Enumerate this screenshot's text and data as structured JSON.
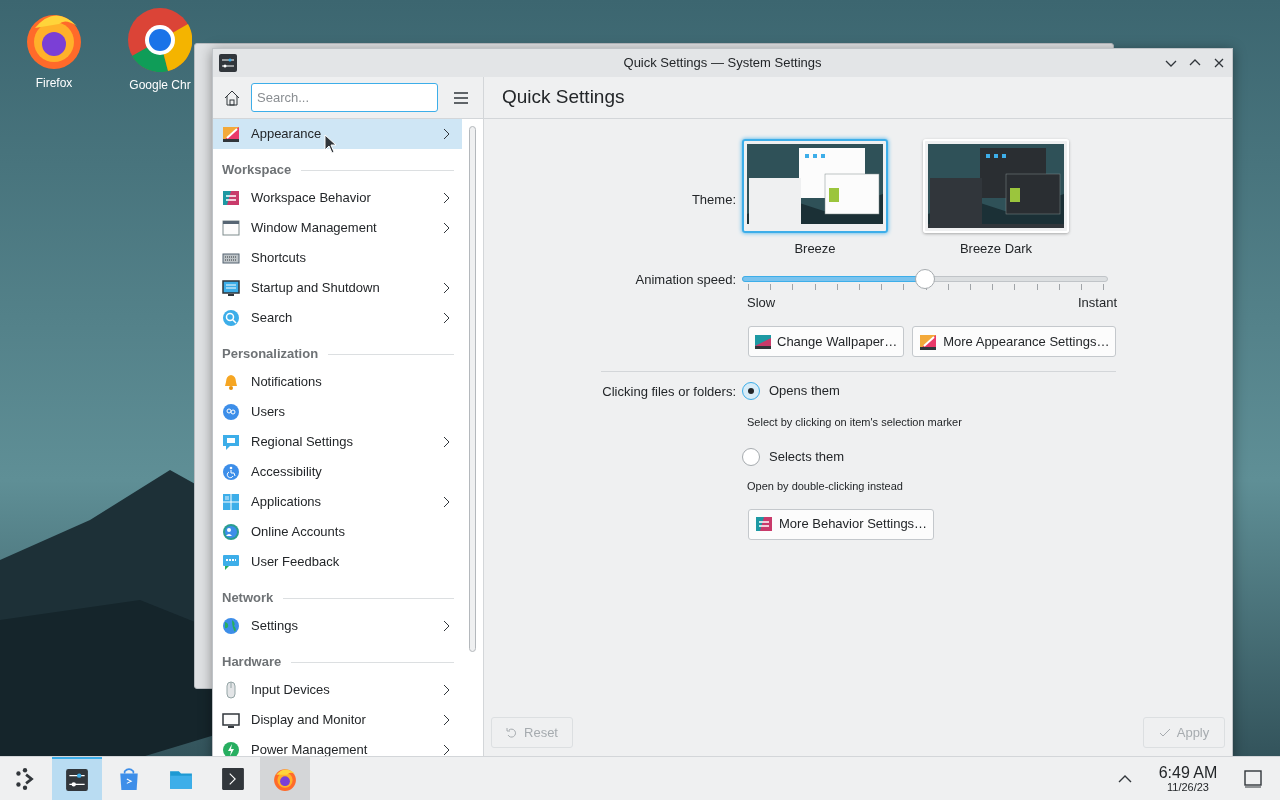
{
  "desktop": {
    "icons": [
      {
        "label": "Firefox"
      },
      {
        "label": "Google Chr"
      }
    ]
  },
  "window": {
    "title": "Quick Settings — System Settings"
  },
  "sidebar": {
    "search": {
      "placeholder": "Search..."
    },
    "top_items": [
      {
        "label": "Appearance",
        "expandable": true,
        "selected": true
      }
    ],
    "sections": [
      {
        "title": "Workspace",
        "items": [
          {
            "label": "Workspace Behavior",
            "expandable": true,
            "selected": false
          },
          {
            "label": "Window Management",
            "expandable": true,
            "selected": false
          },
          {
            "label": "Shortcuts",
            "expandable": false,
            "selected": false
          },
          {
            "label": "Startup and Shutdown",
            "expandable": true,
            "selected": false
          },
          {
            "label": "Search",
            "expandable": true,
            "selected": false
          }
        ]
      },
      {
        "title": "Personalization",
        "items": [
          {
            "label": "Notifications",
            "expandable": false,
            "selected": false
          },
          {
            "label": "Users",
            "expandable": false,
            "selected": false
          },
          {
            "label": "Regional Settings",
            "expandable": true,
            "selected": false
          },
          {
            "label": "Accessibility",
            "expandable": false,
            "selected": false
          },
          {
            "label": "Applications",
            "expandable": true,
            "selected": false
          },
          {
            "label": "Online Accounts",
            "expandable": false,
            "selected": false
          },
          {
            "label": "User Feedback",
            "expandable": false,
            "selected": false
          }
        ]
      },
      {
        "title": "Network",
        "items": [
          {
            "label": "Settings",
            "expandable": true,
            "selected": false
          }
        ]
      },
      {
        "title": "Hardware",
        "items": [
          {
            "label": "Input Devices",
            "expandable": true,
            "selected": false
          },
          {
            "label": "Display and Monitor",
            "expandable": true,
            "selected": false
          },
          {
            "label": "Power Management",
            "expandable": true,
            "selected": false
          }
        ]
      }
    ]
  },
  "page": {
    "title": "Quick Settings",
    "theme": {
      "label": "Theme:",
      "options": [
        {
          "name": "Breeze",
          "selected": true,
          "kind": "light"
        },
        {
          "name": "Breeze Dark",
          "selected": false,
          "kind": "dark"
        }
      ]
    },
    "animation_speed": {
      "label": "Animation speed:",
      "level": 0.5,
      "min_label": "Slow",
      "max_label": "Instant"
    },
    "appearance_buttons": [
      {
        "label": "Change Wallpaper…",
        "kind": "wallpaper"
      },
      {
        "label": "More Appearance Settings…",
        "kind": "appearance"
      }
    ],
    "clicking": {
      "label": "Clicking files or folders:",
      "options": [
        {
          "label": "Opens them",
          "hint": "Select by clicking on item's selection marker",
          "selected": true
        },
        {
          "label": "Selects them",
          "hint": "Open by double-clicking instead",
          "selected": false
        }
      ]
    },
    "behavior_button": {
      "label": "More Behavior Settings…"
    },
    "footer": {
      "reset": {
        "label": "Reset",
        "disabled": true
      },
      "apply": {
        "label": "Apply",
        "disabled": true
      }
    }
  },
  "taskbar": {
    "items": [
      {
        "kind": "launcher",
        "selected": false,
        "hovered": false
      },
      {
        "kind": "settings",
        "selected": true,
        "hovered": false
      },
      {
        "kind": "store",
        "selected": false,
        "hovered": false
      },
      {
        "kind": "files",
        "selected": false,
        "hovered": false
      },
      {
        "kind": "terminal",
        "selected": false,
        "hovered": false
      },
      {
        "kind": "firefox",
        "selected": false,
        "hovered": true
      }
    ],
    "clock": {
      "time": "6:49 AM",
      "date": "11/26/23"
    }
  }
}
